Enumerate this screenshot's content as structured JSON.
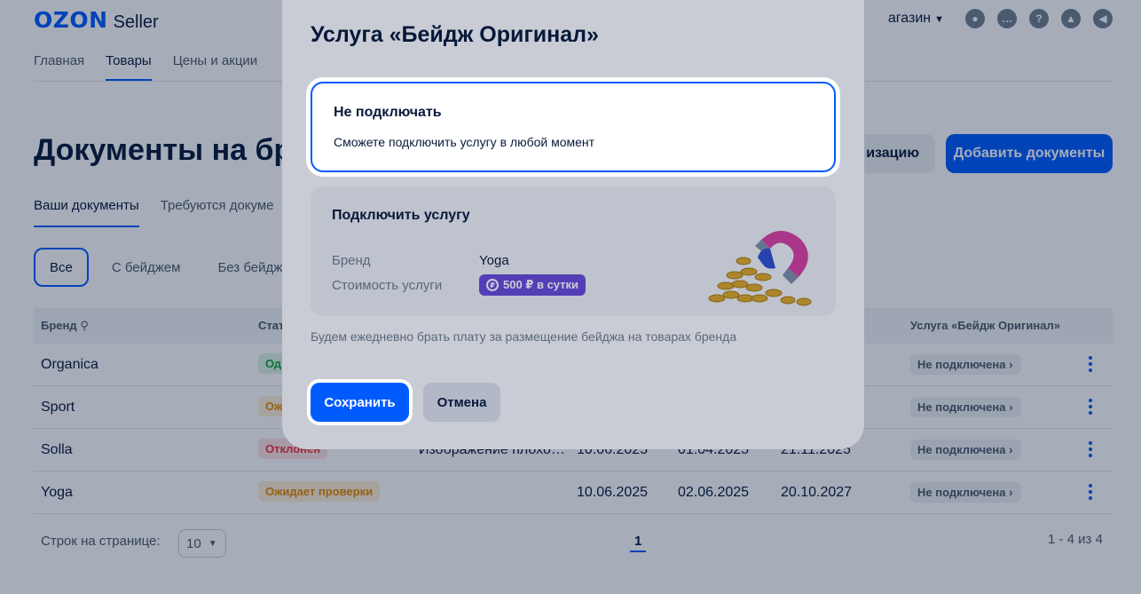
{
  "header": {
    "logo_text": "OZON",
    "logo_suffix": "Seller",
    "store_label": "агазин",
    "icons": [
      "account-icon",
      "chat-icon",
      "help-icon",
      "education-icon",
      "notifications-icon"
    ]
  },
  "nav": {
    "items": [
      {
        "label": "Главная",
        "active": false
      },
      {
        "label": "Товары",
        "active": true
      },
      {
        "label": "Цены и акции",
        "active": false
      }
    ]
  },
  "page": {
    "title": "Документы на бре",
    "secondary_button": "изацию",
    "add_documents_button": "Добавить документы",
    "subtabs": [
      {
        "label": "Ваши документы",
        "active": true
      },
      {
        "label": "Требуются докуме",
        "active": false
      }
    ],
    "filters": [
      {
        "label": "Все",
        "active": true
      },
      {
        "label": "С бейджем",
        "active": false
      },
      {
        "label": "Без бейджа",
        "active": false
      }
    ]
  },
  "table": {
    "headers": {
      "brand": "Бренд",
      "status": "Стат",
      "service": "Услуга «Бейдж Оригинал»"
    },
    "rows": [
      {
        "brand": "Organica",
        "status": "Од",
        "status_kind": "green",
        "comment": "",
        "d1": "",
        "d2": "",
        "d3": "",
        "service": "Не подключена"
      },
      {
        "brand": "Sport",
        "status": "Ож",
        "status_kind": "orange",
        "comment": "",
        "d1": "",
        "d2": "",
        "d3": "",
        "service": "Не подключена"
      },
      {
        "brand": "Solla",
        "status": "Отклонен",
        "status_kind": "red",
        "comment": "Изображение плохо…",
        "d1": "10.06.2025",
        "d2": "01.04.2025",
        "d3": "21.11.2025",
        "service": "Не подключена"
      },
      {
        "brand": "Yoga",
        "status": "Ожидает проверки",
        "status_kind": "orange",
        "comment": "",
        "d1": "10.06.2025",
        "d2": "02.06.2025",
        "d3": "20.10.2027",
        "service": "Не подключена"
      }
    ]
  },
  "pagination": {
    "rows_label": "Строк на странице:",
    "rows_value": "10",
    "current_page": "1",
    "range": "1 - 4 из 4"
  },
  "modal": {
    "title": "Услуга «Бейдж Оригинал»",
    "option_off": {
      "title": "Не подключать",
      "description": "Сможете подключить услугу в любой момент",
      "selected": true
    },
    "option_on": {
      "title": "Подключить услугу",
      "brand_label": "Бренд",
      "brand_value": "Yoga",
      "price_label": "Стоимость услуги",
      "price_value": "500 ₽ в сутки",
      "selected": false
    },
    "note": "Будем ежедневно брать плату за размещение бейджа на товарах бренда",
    "save_button": "Сохранить",
    "cancel_button": "Отмена"
  },
  "colors": {
    "accent": "#005bff",
    "price_badge": "#6a4ad8",
    "text": "#07193a"
  }
}
